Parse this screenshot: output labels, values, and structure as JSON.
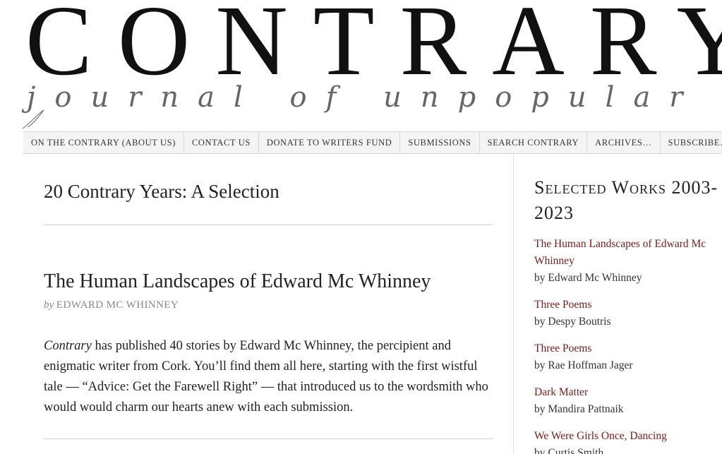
{
  "masthead": {
    "title": "CONTRARY",
    "subtitle": "journal of unpopular discontent"
  },
  "nav": {
    "items": [
      "ON THE CONTRARY (ABOUT US)",
      "CONTACT US",
      "DONATE TO WRITERS FUND",
      "SUBMISSIONS",
      "SEARCH CONTRARY",
      "ARCHIVES…",
      "SUBSCRIBE…"
    ]
  },
  "main": {
    "page_title": "20 Contrary Years: A Selection",
    "article": {
      "title": "The Human Landscapes of Edward Mc Whinney",
      "by_prefix": "by",
      "author": "EDWARD MC WHINNEY",
      "excerpt_italic": "Contrary",
      "excerpt_rest": " has published 40 stories by Edward Mc Whinney, the percipient and enigmatic writer from Cork. You’ll find them all here, starting with the first wistful tale — “Advice: Get the Farewell Right” — that introduced us to the wordsmith who would would charm our hearts anew with each submission."
    }
  },
  "sidebar": {
    "heading": "Selected Works 2003-2023",
    "works": [
      {
        "title": "The Human Landscapes of Edward Mc Whinney",
        "by": "by Edward Mc Whinney"
      },
      {
        "title": "Three Poems",
        "by": "by Despy Boutris"
      },
      {
        "title": "Three Poems",
        "by": "by Rae Hoffman Jager"
      },
      {
        "title": "Dark Matter",
        "by": "by Mandira Pattnaik"
      },
      {
        "title": "We Were Girls Once, Dancing",
        "by": "by Curtis Smith"
      }
    ]
  },
  "colors": {
    "link": "#7a1a1a",
    "nav_bg": "#f4f4f4",
    "byline": "#888888"
  }
}
